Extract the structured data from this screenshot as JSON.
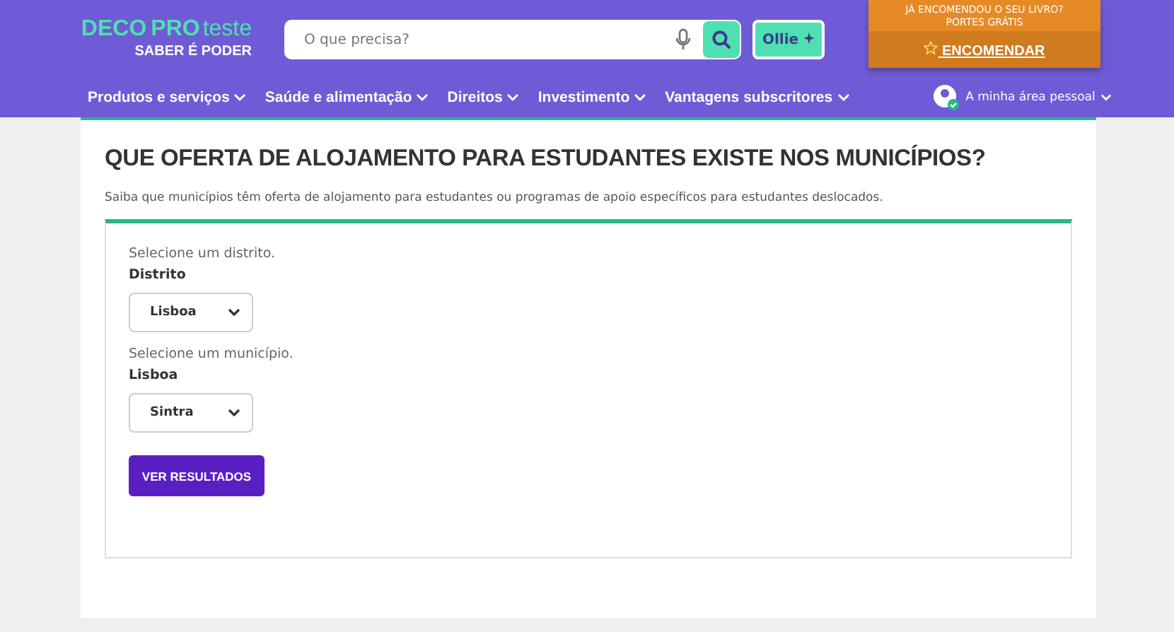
{
  "logo": {
    "brand_a": "DECO",
    "brand_b": "PRO",
    "brand_c": "teste",
    "tagline": "SABER É PODER"
  },
  "search": {
    "placeholder": "O que precisa?"
  },
  "assistant_button": "Ollie",
  "promo": {
    "text_1": "JÁ ENCOMENDOU O SEU LIVRO?",
    "text_2": "PORTES GRÁTIS",
    "button": "ENCOMENDAR"
  },
  "nav": [
    {
      "label": "Produtos e serviços"
    },
    {
      "label": "Saúde e alimentação"
    },
    {
      "label": "Direitos"
    },
    {
      "label": "Investimento"
    },
    {
      "label": "Vantagens subscritores"
    }
  ],
  "account": "A minha área pessoal",
  "heading": "QUE OFERTA DE ALOJAMENTO PARA ESTUDANTES EXISTE NOS MUNICÍPIOS?",
  "intro": "Saiba que municípios têm oferta de alojamento para estudantes ou programas de apoio específicos para estudantes deslocados.",
  "fields": [
    {
      "hint": "Selecione um distrito.",
      "label": "Distrito",
      "value": "Lisboa"
    },
    {
      "hint": "Selecione um município.",
      "label": "Lisboa",
      "value": "Sintra"
    }
  ],
  "submit": "VER RESULTADOS"
}
